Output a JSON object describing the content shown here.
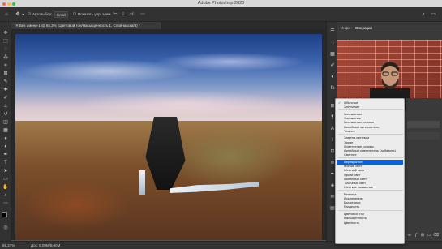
{
  "window": {
    "title": "Adobe Photoshop 2020"
  },
  "options_bar": {
    "auto_select_label": "Автовыбор:",
    "auto_select_value": "Слой",
    "show_controls_label": "Показать упр. элем."
  },
  "document": {
    "tab_label": "Без имени-1 @ 65,3% (Цветовой тон/Насыщенность 1, Слой-маска/8) *",
    "zoom": "65,27%",
    "doc_info": "Док: 8,09М/5,90М"
  },
  "panels": {
    "tab1": "Инфо",
    "tab2": "Операции",
    "opacity_label": "прозрачность:",
    "opacity_value": "100%",
    "fill_label": "Заливка:",
    "fill_value": "100%"
  },
  "blend_menu": {
    "selected": "Перекрытие",
    "groups": [
      [
        "Обычные",
        "Затухание"
      ],
      [
        "Затемнение",
        "Умножение",
        "Затемнение основы",
        "Линейный затемнитель",
        "Темнее"
      ],
      [
        "Замена светлым",
        "Экран",
        "Осветление основы",
        "Линейный осветлитель (добавить)",
        "Светлее"
      ],
      [
        "Перекрытие",
        "Мягкий свет",
        "Жесткий свет",
        "Яркий свет",
        "Линейный свет",
        "Точечный свет",
        "Жесткое смешение"
      ],
      [
        "Разница",
        "Исключение",
        "Вычитание",
        "Разделить"
      ],
      [
        "Цветовой тон",
        "Насыщенность",
        "Цветность"
      ]
    ]
  },
  "colors": {
    "highlight": "#0a61d9",
    "traffic_red": "#ff5f57",
    "traffic_yellow": "#febc2e",
    "traffic_green": "#28c840"
  }
}
